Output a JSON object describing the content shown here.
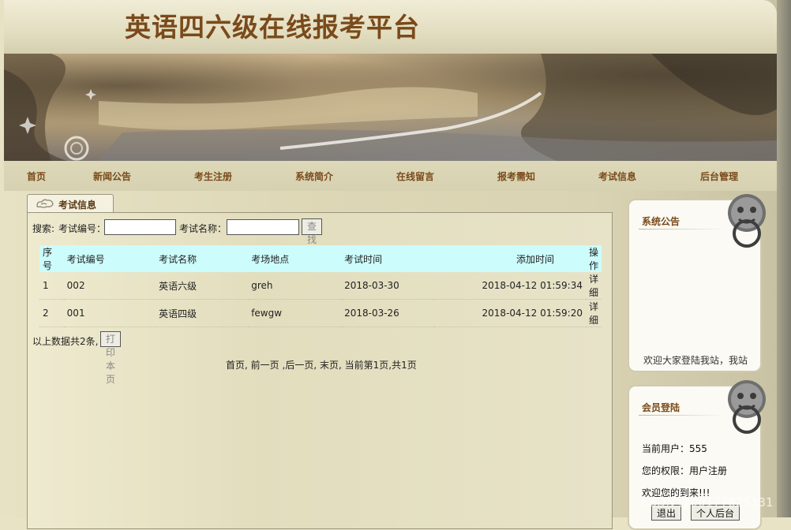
{
  "site": {
    "title": "英语四六级在线报考平台"
  },
  "nav": {
    "items": [
      {
        "label": "首页"
      },
      {
        "label": "新闻公告"
      },
      {
        "label": "考生注册"
      },
      {
        "label": "系统简介"
      },
      {
        "label": "在线留言"
      },
      {
        "label": "报考需知"
      },
      {
        "label": "考试信息"
      },
      {
        "label": "后台管理"
      }
    ]
  },
  "main": {
    "tab_label": "考试信息",
    "search": {
      "prefix": "搜索:",
      "field1_label": "考试编号：",
      "field1_value": "",
      "field2_label": "考试名称：",
      "field2_value": "",
      "button": "查找"
    },
    "table": {
      "headers": [
        "序号",
        "考试编号",
        "考试名称",
        "考场地点",
        "考试时间",
        "添加时间",
        "操作"
      ],
      "rows": [
        {
          "index": "1",
          "code": "002",
          "name": "英语六级",
          "location": "greh",
          "exam_date": "2018-03-30",
          "added": "2018-04-12 01:59:34",
          "action": "详细"
        },
        {
          "index": "2",
          "code": "001",
          "name": "英语四级",
          "location": "fewgw",
          "exam_date": "2018-03-26",
          "added": "2018-04-12 01:59:20",
          "action": "详细"
        }
      ]
    },
    "summary": "以上数据共2条,",
    "print_button": "打印本页",
    "pager": {
      "first": "首页",
      "prev": "前一页",
      "next": "后一页",
      "last": "末页",
      "status": "当前第1页,共1页"
    }
  },
  "sidebar": {
    "notice": {
      "title": "系统公告",
      "text": "欢迎大家登陆我站，我站"
    },
    "login": {
      "title": "会员登陆",
      "current_user": "当前用户：555",
      "role": "您的权限：用户注册",
      "welcome": "欢迎您的到来!!!",
      "logout_button": "退出",
      "backend_button": "个人后台"
    }
  },
  "watermark": "CSDN @00177825331",
  "colors": {
    "accent_brown": "#7a4a1b",
    "table_header_bg": "#ccfcfc",
    "page_bg": "#e8e3c4"
  }
}
